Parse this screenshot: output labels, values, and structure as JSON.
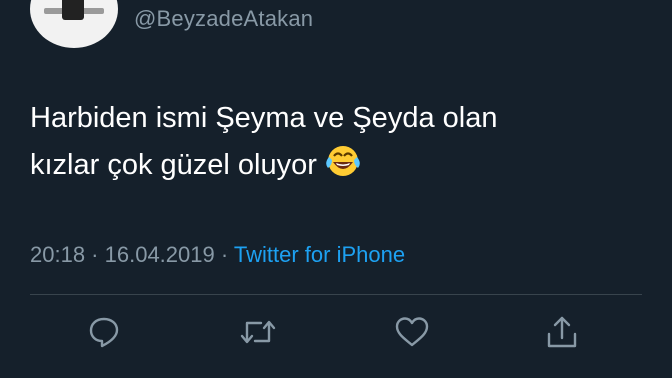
{
  "author": {
    "handle": "@BeyzadeAtakan"
  },
  "tweet": {
    "line1": "Harbiden ismi Şeyma ve Şeyda olan",
    "line2": "kızlar çok güzel oluyor",
    "emoji": "laughing-with-tears"
  },
  "meta": {
    "time": "20:18",
    "separator1": " · ",
    "date": "16.04.2019",
    "separator2": " · ",
    "source": "Twitter for iPhone"
  },
  "actions": {
    "icons": [
      "reply-icon",
      "retweet-icon",
      "like-icon",
      "share-icon"
    ]
  },
  "colors": {
    "background": "#15202b",
    "text": "#ffffff",
    "secondary": "#8899a6",
    "accent": "#1da1f2",
    "divider": "#38444d"
  }
}
